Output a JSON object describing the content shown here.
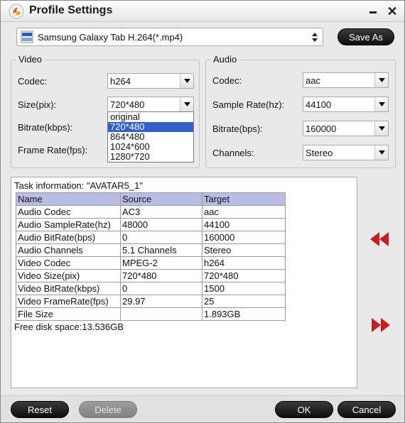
{
  "window": {
    "title": "Profile Settings"
  },
  "profile": {
    "selected": "Samsung Galaxy Tab H.264(*.mp4)",
    "save_as_label": "Save As"
  },
  "video": {
    "title": "Video",
    "codec_label": "Codec:",
    "codec_value": "h264",
    "size_label": "Size(pix):",
    "size_value": "720*480",
    "size_options": [
      "original",
      "720*480",
      "864*480",
      "1024*600",
      "1280*720"
    ],
    "size_highlighted_option": "720*480",
    "bitrate_label": "Bitrate(kbps):",
    "framerate_label": "Frame Rate(fps):"
  },
  "audio": {
    "title": "Audio",
    "codec_label": "Codec:",
    "codec_value": "aac",
    "samplerate_label": "Sample Rate(hz):",
    "samplerate_value": "44100",
    "bitrate_label": "Bitrate(bps):",
    "bitrate_value": "160000",
    "channels_label": "Channels:",
    "channels_value": "Stereo"
  },
  "task": {
    "info": "Task information: \"AVATAR5_1\"",
    "columns": [
      "Name",
      "Source",
      "Target"
    ],
    "rows": [
      [
        "Audio Codec",
        "AC3",
        "aac"
      ],
      [
        "Audio SampleRate(hz)",
        "48000",
        "44100"
      ],
      [
        "Audio BitRate(bps)",
        "0",
        "160000"
      ],
      [
        "Audio Channels",
        "5.1 Channels",
        "Stereo"
      ],
      [
        "Video Codec",
        "MPEG-2",
        "h264"
      ],
      [
        "Video Size(pix)",
        "720*480",
        "720*480"
      ],
      [
        "Video BitRate(kbps)",
        "0",
        "1500"
      ],
      [
        "Video FrameRate(fps)",
        "29.97",
        "25"
      ],
      [
        "File Size",
        "",
        "1.893GB"
      ]
    ],
    "disk_space": "Free disk space:13.536GB"
  },
  "buttons": {
    "reset": "Reset",
    "delete": "Delete",
    "ok": "OK",
    "cancel": "Cancel"
  },
  "colors": {
    "table_header": "#b8bde6",
    "selection": "#3161c7",
    "arrow_red": "#c81e1e"
  }
}
